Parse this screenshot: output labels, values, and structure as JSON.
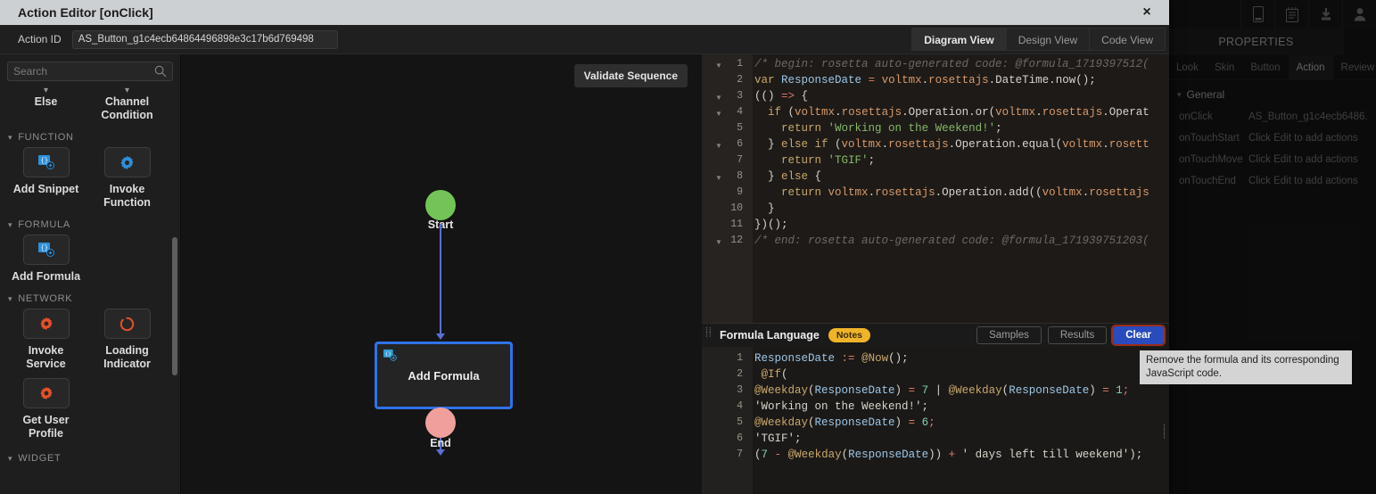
{
  "app": {
    "topbar_icons": [
      "device-icon",
      "notes-icon",
      "download-icon",
      "user-icon"
    ]
  },
  "properties": {
    "title": "PROPERTIES",
    "tabs": [
      {
        "label": "Look",
        "active": false
      },
      {
        "label": "Skin",
        "active": false
      },
      {
        "label": "Button",
        "active": false
      },
      {
        "label": "Action",
        "active": true
      },
      {
        "label": "Review",
        "active": false
      }
    ],
    "section": "General",
    "rows": [
      {
        "key": "onClick",
        "value": "AS_Button_g1c4ecb6486."
      },
      {
        "key": "onTouchStart",
        "value": "Click Edit to add actions"
      },
      {
        "key": "onTouchMove",
        "value": "Click Edit to add actions"
      },
      {
        "key": "onTouchEnd",
        "value": "Click Edit to add actions"
      }
    ]
  },
  "modal": {
    "title": "Action Editor [onClick]",
    "close_glyph": "×",
    "action_id_label": "Action ID",
    "action_id_value": "AS_Button_g1c4ecb64864496898e3c17b6d769498",
    "view_tabs": [
      {
        "label": "Diagram View",
        "active": true
      },
      {
        "label": "Design View",
        "active": false
      },
      {
        "label": "Code View",
        "active": false
      }
    ]
  },
  "sidebar": {
    "search_placeholder": "Search",
    "top_items": [
      {
        "label": "Else"
      },
      {
        "label": "Channel Condition"
      }
    ],
    "groups": [
      {
        "name": "FUNCTION",
        "items": [
          {
            "label": "Add Snippet",
            "icon": "snippet-icon"
          },
          {
            "label": "Invoke Function",
            "icon": "gear-blue-icon"
          }
        ]
      },
      {
        "name": "FORMULA",
        "items": [
          {
            "label": "Add Formula",
            "icon": "formula-icon"
          }
        ]
      },
      {
        "name": "NETWORK",
        "items": [
          {
            "label": "Invoke Service",
            "icon": "gear-orange-icon"
          },
          {
            "label": "Loading Indicator",
            "icon": "spinner-orange-icon"
          },
          {
            "label": "Get User Profile",
            "icon": "gear-orange-icon"
          }
        ]
      },
      {
        "name": "WIDGET",
        "items": []
      }
    ]
  },
  "canvas": {
    "validate_button": "Validate Sequence",
    "nodes": [
      {
        "id": "start",
        "label": "Start",
        "type": "terminator",
        "color": "#72c456"
      },
      {
        "id": "formula",
        "label": "Add Formula",
        "type": "action",
        "selected": true,
        "border": "#2f72e8"
      },
      {
        "id": "end",
        "label": "End",
        "type": "terminator",
        "color": "#f0a09c"
      }
    ]
  },
  "code_editor": {
    "lines": [
      {
        "n": 1,
        "fold": true
      },
      {
        "n": 2,
        "fold": false
      },
      {
        "n": 3,
        "fold": true
      },
      {
        "n": 4,
        "fold": true
      },
      {
        "n": 5,
        "fold": false
      },
      {
        "n": 6,
        "fold": true
      },
      {
        "n": 7,
        "fold": false
      },
      {
        "n": 8,
        "fold": true
      },
      {
        "n": 9,
        "fold": false
      },
      {
        "n": 10,
        "fold": false
      },
      {
        "n": 11,
        "fold": false
      },
      {
        "n": 12,
        "fold": true
      }
    ],
    "text": [
      "/* begin: rosetta auto-generated code: @formula_1719397512(",
      "var ResponseDate = voltmx.rosettajs.DateTime.now();",
      "(() => {",
      "  if (voltmx.rosettajs.Operation.or(voltmx.rosettajs.Operat",
      "    return 'Working on the Weekend!';",
      "  } else if (voltmx.rosettajs.Operation.equal(voltmx.rosett",
      "    return 'TGIF';",
      "  } else {",
      "    return voltmx.rosettajs.Operation.add((voltmx.rosettajs",
      "  }",
      "})();",
      "/* end: rosetta auto-generated code: @formula_171939751203("
    ]
  },
  "formula_panel": {
    "title": "Formula Language",
    "badge": "Notes",
    "buttons": [
      {
        "label": "Samples",
        "primary": false
      },
      {
        "label": "Results",
        "primary": false
      },
      {
        "label": "Clear",
        "primary": true
      }
    ],
    "line_numbers": [
      1,
      2,
      3,
      4,
      5,
      6,
      7
    ],
    "text": [
      "ResponseDate := @Now();",
      " @If(",
      "@Weekday(ResponseDate) = 7 | @Weekday(ResponseDate) = 1;",
      "'Working on the Weekend!';",
      "@Weekday(ResponseDate) = 6;",
      "'TGIF';",
      "(7 - @Weekday(ResponseDate)) + ' days left till weekend');"
    ]
  },
  "tooltip": {
    "text": "Remove the formula and its corresponding JavaScript code."
  },
  "colors": {
    "accent_blue": "#2f72e8",
    "button_blue": "#2a4bbd",
    "highlight_red": "#9b2d16",
    "badge_yellow": "#f0b429",
    "start_green": "#72c456",
    "end_pink": "#f0a09c"
  }
}
